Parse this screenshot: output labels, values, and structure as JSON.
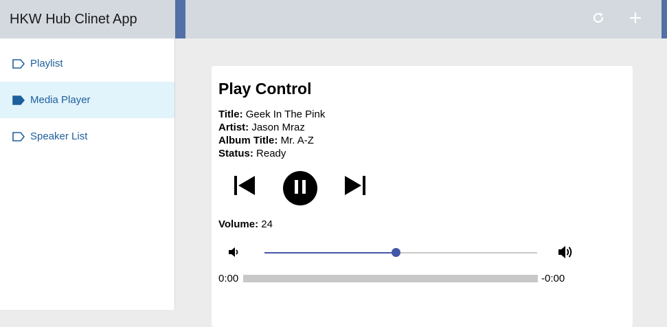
{
  "app": {
    "title": "HKW Hub Clinet App"
  },
  "sidebar": {
    "items": [
      {
        "label": "Playlist",
        "active": false
      },
      {
        "label": "Media Player",
        "active": true
      },
      {
        "label": "Speaker List",
        "active": false
      }
    ]
  },
  "toolbar": {
    "icons": [
      "refresh-icon",
      "plus-icon"
    ]
  },
  "player": {
    "heading": "Play Control",
    "title_label": "Title:",
    "title": "Geek In The Pink",
    "artist_label": "Artist:",
    "artist": "Jason Mraz",
    "album_label": "Album Title:",
    "album": "Mr. A-Z",
    "status_label": "Status:",
    "status": "Ready",
    "volume_label": "Volume:",
    "volume": "24",
    "volume_fraction": 0.48,
    "elapsed": "0:00",
    "remaining": "-0:00",
    "progress_fraction": 0
  },
  "colors": {
    "accent": "#4456a8",
    "header_bg": "#d3d9df",
    "header_accent": "#5270a5",
    "nav_text": "#1d5f9c",
    "nav_active_bg": "#e1f3fb"
  }
}
